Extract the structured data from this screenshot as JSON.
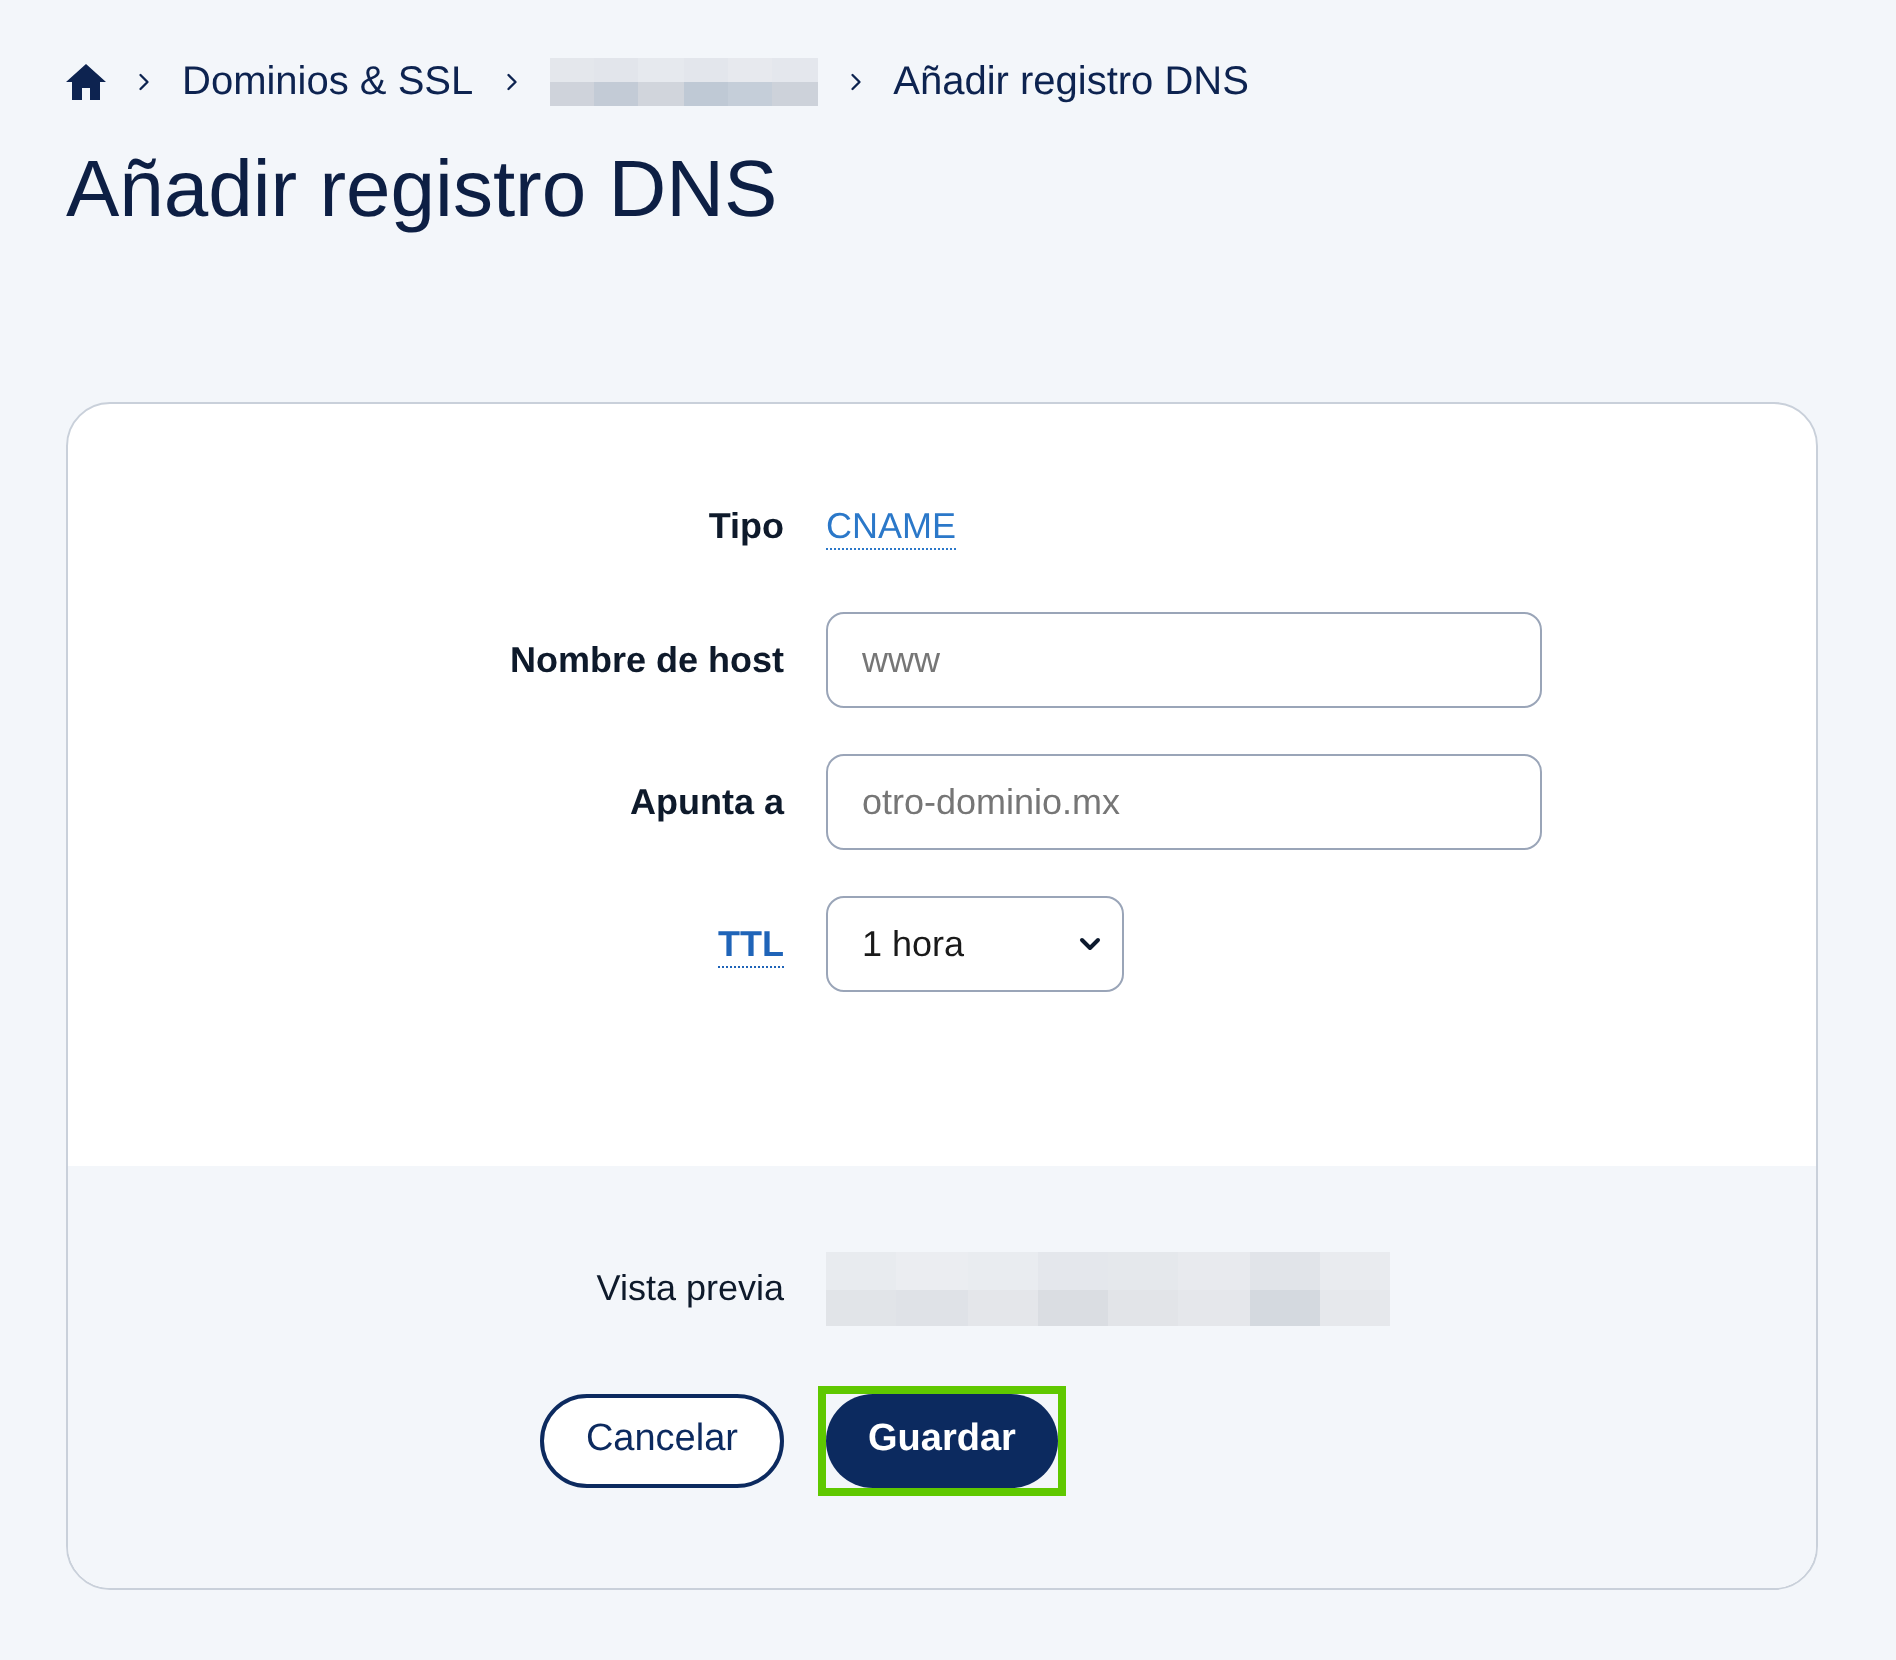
{
  "breadcrumb": [
    {
      "kind": "home"
    },
    {
      "kind": "link",
      "label": "Dominios & SSL"
    },
    {
      "kind": "redacted"
    },
    {
      "kind": "current",
      "label": "Añadir registro DNS"
    }
  ],
  "title": "Añadir registro DNS",
  "fields": [
    {
      "label": "Tipo",
      "has_tooltip": false,
      "kind": "static",
      "value": "CNAME"
    },
    {
      "label": "Nombre de host",
      "has_tooltip": false,
      "kind": "input",
      "placeholder": "www"
    },
    {
      "label": "Apunta a",
      "has_tooltip": false,
      "kind": "input",
      "placeholder": "otro-dominio.mx"
    },
    {
      "label": "TTL",
      "has_tooltip": true,
      "kind": "select",
      "value": "1 hora"
    }
  ],
  "preview": {
    "label": "Vista previa",
    "redacted": true
  },
  "actions": [
    {
      "label": "Cancelar",
      "kind": "secondary",
      "highlighted": false
    },
    {
      "label": "Guardar",
      "kind": "primary",
      "highlighted": true
    }
  ]
}
